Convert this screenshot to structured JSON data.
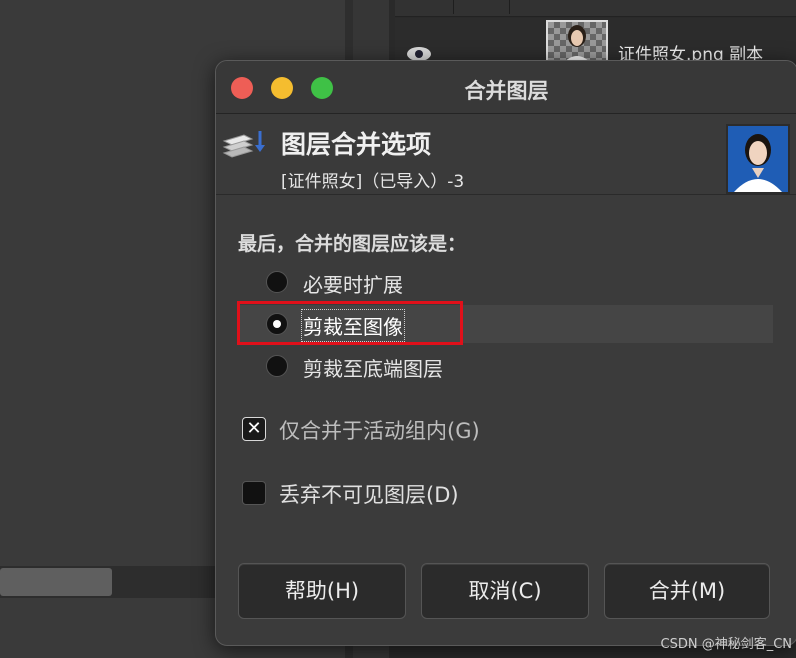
{
  "background": {
    "layer_name": "证件照女.png 副本"
  },
  "dialog": {
    "window_title": "合并图层",
    "header_title": "图层合并选项",
    "header_subtitle": "[证件照女]（已导入）-3",
    "section_label": "最后，合并的图层应该是：",
    "radio_options": [
      {
        "label": "必要时扩展",
        "checked": false
      },
      {
        "label": "剪裁至图像",
        "checked": true
      },
      {
        "label": "剪裁至底端图层",
        "checked": false
      }
    ],
    "checkbox_active_group": {
      "label": "仅合并于活动组内(G)",
      "checked": true
    },
    "checkbox_discard_invisible": {
      "label": "丢弃不可见图层(D)",
      "checked": false
    },
    "buttons": {
      "help": "帮助(H)",
      "cancel": "取消(C)",
      "merge": "合并(M)"
    }
  },
  "watermark": "CSDN @神秘剑客_CN",
  "colors": {
    "highlight": "#e0101a",
    "close": "#ee5e56",
    "minimize": "#f5bd2f",
    "maximize": "#3fc146"
  }
}
